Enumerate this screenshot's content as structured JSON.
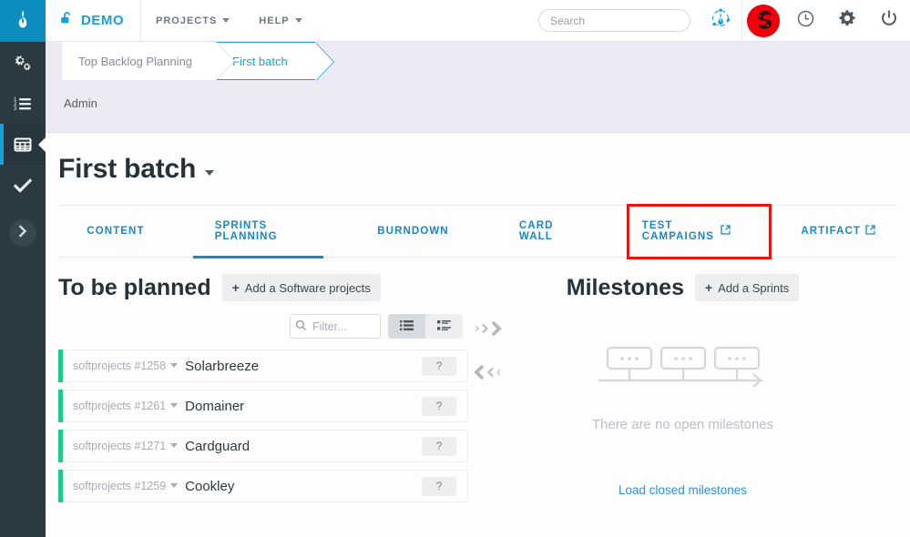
{
  "sidebar": {
    "logo_icon": "tuleap-leaf-logo",
    "items": [
      {
        "icon": "gears-icon",
        "name": "sidebar-item-admin",
        "active": false
      },
      {
        "icon": "numbered-list-icon",
        "name": "sidebar-item-backlog",
        "active": false
      },
      {
        "icon": "grid-table-icon",
        "name": "sidebar-item-agile-dashboard",
        "active": true
      },
      {
        "icon": "check-icon",
        "name": "sidebar-item-tests",
        "active": false
      }
    ],
    "expand_icon": "chevron-right-icon"
  },
  "topnav": {
    "lock_icon": "unlock-icon",
    "project_name": "DEMO",
    "links": [
      {
        "label": "PROJECTS",
        "caret": true
      },
      {
        "label": "HELP",
        "caret": true
      }
    ],
    "search": {
      "placeholder": "Search",
      "value": ""
    },
    "network_icon": "tuleap-network-icon",
    "avatar_icon": "user-avatar",
    "icons": [
      {
        "name": "clock-icon"
      },
      {
        "name": "gear-icon"
      },
      {
        "name": "power-icon"
      }
    ]
  },
  "breadcrumb": {
    "items": [
      {
        "label": "Top Backlog Planning",
        "current": false
      },
      {
        "label": "First batch",
        "current": true
      }
    ],
    "sub_label": "Admin"
  },
  "page": {
    "title": "First batch",
    "title_caret_icon": "caret-down-icon"
  },
  "tabs": [
    {
      "label": "CONTENT",
      "active": false,
      "external": false
    },
    {
      "label": "SPRINTS PLANNING",
      "active": true,
      "external": false
    },
    {
      "label": "BURNDOWN",
      "active": false,
      "external": false
    },
    {
      "label": "CARD WALL",
      "active": false,
      "external": false
    },
    {
      "label": "TEST CAMPAIGNS",
      "active": false,
      "external": true,
      "highlighted": true
    },
    {
      "label": "ARTIFACT",
      "active": false,
      "external": true
    }
  ],
  "highlight": {
    "color": "#ee1111"
  },
  "backlog_panel": {
    "title": "To be planned",
    "add_button": {
      "plus": "+",
      "label": "Add a Software projects"
    },
    "filter": {
      "placeholder": "Filter...",
      "value": "",
      "icon": "search-icon"
    },
    "view_modes": [
      {
        "name": "list-view-button",
        "icon": "list-ul-icon",
        "active": true
      },
      {
        "name": "detailed-view-button",
        "icon": "list-detail-icon",
        "active": false
      }
    ],
    "items": [
      {
        "id": "softprojects #1258",
        "title": "Solarbreeze",
        "badge": "?"
      },
      {
        "id": "softprojects #1261",
        "title": "Domainer",
        "badge": "?"
      },
      {
        "id": "softprojects #1271",
        "title": "Cardguard",
        "badge": "?"
      },
      {
        "id": "softprojects #1259",
        "title": "Cookley",
        "badge": "?"
      }
    ],
    "accent_color": "#1ecb8a"
  },
  "milestones_panel": {
    "title": "Milestones",
    "add_button": {
      "plus": "+",
      "label": "Add a Sprints"
    },
    "move_right_icon": "chevrons-right-icon",
    "move_left_icon": "chevrons-left-icon",
    "empty_illustration": "milestone-timeline-illustration",
    "empty_text": "There are no open milestones",
    "load_closed_link": "Load closed milestones"
  }
}
